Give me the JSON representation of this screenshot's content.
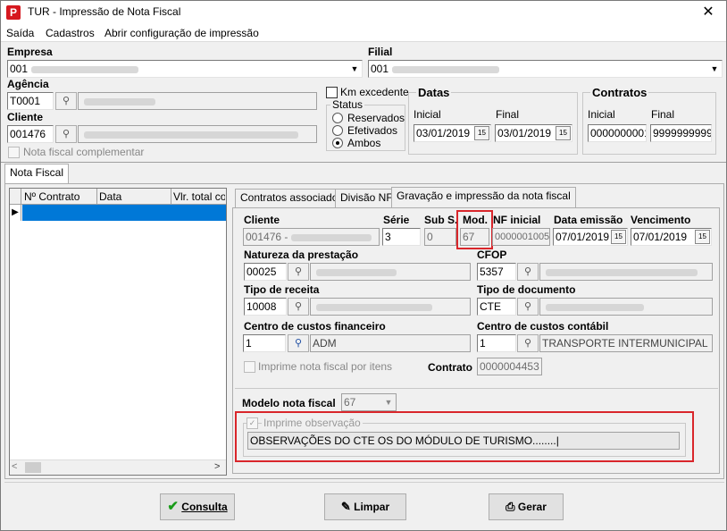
{
  "window": {
    "title": "TUR - Impressão de Nota Fiscal",
    "app_icon": "P",
    "close_glyph": "✕"
  },
  "menu": {
    "items": [
      "Saída",
      "Cadastros",
      "Abrir configuração de impressão"
    ]
  },
  "header": {
    "empresa_label": "Empresa",
    "empresa_code": "001",
    "filial_label": "Filial",
    "filial_code": "001",
    "agencia_label": "Agência",
    "agencia_value": "T0001",
    "cliente_label": "Cliente",
    "cliente_value": "001476",
    "nf_complementar_label": "Nota fiscal complementar",
    "km_excedente_label": "Km excedente",
    "status_title": "Status",
    "status_options": [
      "Reservados",
      "Efetivados",
      "Ambos"
    ],
    "status_selected": "Ambos",
    "datas_title": "Datas",
    "datas_inicial_label": "Inicial",
    "datas_final_label": "Final",
    "datas_inicial": "03/01/2019",
    "datas_final": "03/01/2019",
    "contratos_title": "Contratos",
    "contratos_inicial_label": "Inicial",
    "contratos_final_label": "Final",
    "contratos_inicial": "0000000001",
    "contratos_final": "9999999999"
  },
  "outer_tab": "Nota Fiscal",
  "grid": {
    "columns": [
      "Nº Contrato",
      "Data",
      "Vlr. total cor"
    ]
  },
  "inner_tabs": [
    "Contratos associados",
    "Divisão NF",
    "Gravação e impressão da nota fiscal"
  ],
  "form": {
    "cliente_label": "Cliente",
    "cliente_value": "001476 -",
    "serie_label": "Série",
    "serie_value": "3",
    "subserie_label": "Sub S.",
    "subserie_value": "0",
    "mod_label": "Mod.",
    "mod_value": "67",
    "nf_inicial_label": "NF inicial",
    "nf_inicial_value": "0000001005",
    "data_emissao_label": "Data emissão",
    "data_emissao_value": "07/01/2019",
    "vencimento_label": "Vencimento",
    "vencimento_value": "07/01/2019",
    "natureza_label": "Natureza da prestação",
    "natureza_code": "00025",
    "cfop_label": "CFOP",
    "cfop_code": "5357",
    "tipo_receita_label": "Tipo de receita",
    "tipo_receita_code": "10008",
    "tipo_documento_label": "Tipo de documento",
    "tipo_documento_code": "CTE",
    "ccf_label": "Centro de custos financeiro",
    "ccf_code": "1",
    "ccf_desc": "ADM",
    "ccc_label": "Centro de custos contábil",
    "ccc_code": "1",
    "ccc_desc": "TRANSPORTE INTERMUNICIPAL",
    "imprime_itens_label": "Imprime nota fiscal por itens",
    "contrato_label": "Contrato",
    "contrato_value": "0000004453",
    "modelo_label": "Modelo nota fiscal",
    "modelo_value": "67",
    "imprime_obs_label": "Imprime observação",
    "observacao": "OBSERVAÇÕES DO CTE OS DO MÓDULO DE TURISMO........|"
  },
  "buttons": {
    "consulta": "Consulta",
    "limpar": "Limpar",
    "gerar": "Gerar"
  },
  "colors": {
    "selection": "#0078d7",
    "highlight": "#d9262b",
    "brand": "#d6181f"
  }
}
